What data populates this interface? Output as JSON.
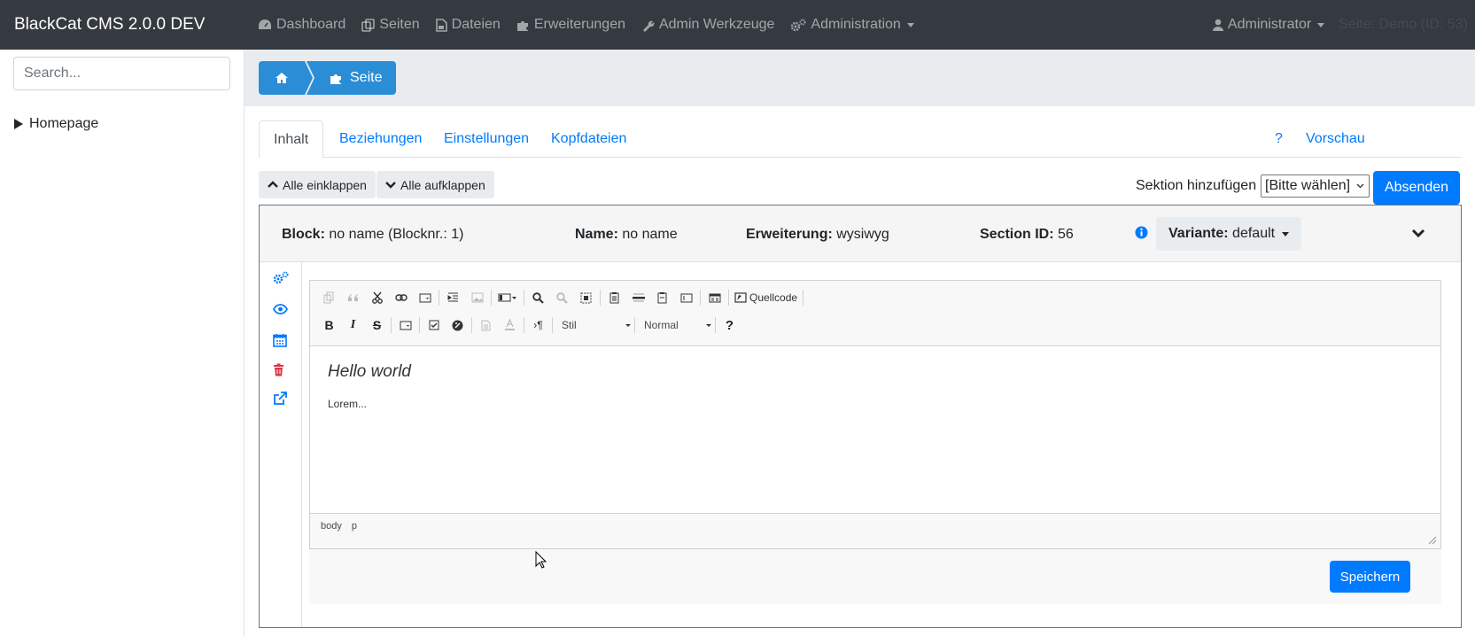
{
  "navbar": {
    "brand": "BlackCat CMS 2.0.0 DEV",
    "items": [
      "Dashboard",
      "Seiten",
      "Dateien",
      "Erweiterungen",
      "Admin Werkzeuge",
      "Administration"
    ],
    "user": "Administrator",
    "page_info": "Seite: Demo (ID: 53)"
  },
  "sidebar": {
    "search_placeholder": "Search...",
    "tree": [
      "Homepage"
    ]
  },
  "breadcrumb": {
    "page": "Seite"
  },
  "tabs": {
    "items": [
      "Inhalt",
      "Beziehungen",
      "Einstellungen",
      "Kopfdateien"
    ],
    "active": "Inhalt",
    "help": "?",
    "preview": "Vorschau"
  },
  "actions": {
    "collapse_all": "Alle einklappen",
    "expand_all": "Alle aufklappen",
    "add_section_label": "Sektion hinzufügen",
    "add_section_value": "[Bitte wählen]",
    "submit": "Absenden"
  },
  "block": {
    "block_label": "Block:",
    "block_value": "no name (Blocknr.: 1)",
    "name_label": "Name:",
    "name_value": "no name",
    "ext_label": "Erweiterung:",
    "ext_value": "wysiwyg",
    "section_label": "Section ID:",
    "section_value": "56",
    "variant_label": "Variante:",
    "variant_value": "default"
  },
  "editor": {
    "source_label": "Quellcode",
    "style_combo": "Stil",
    "format_combo": "Normal",
    "heading": "Hello world",
    "paragraph": "Lorem...",
    "path": [
      "body",
      "p"
    ],
    "save": "Speichern"
  },
  "colors": {
    "navbar": "#343a40",
    "primary": "#007bff",
    "breadcrumb": "#2b8dd6",
    "danger": "#dc3545"
  }
}
